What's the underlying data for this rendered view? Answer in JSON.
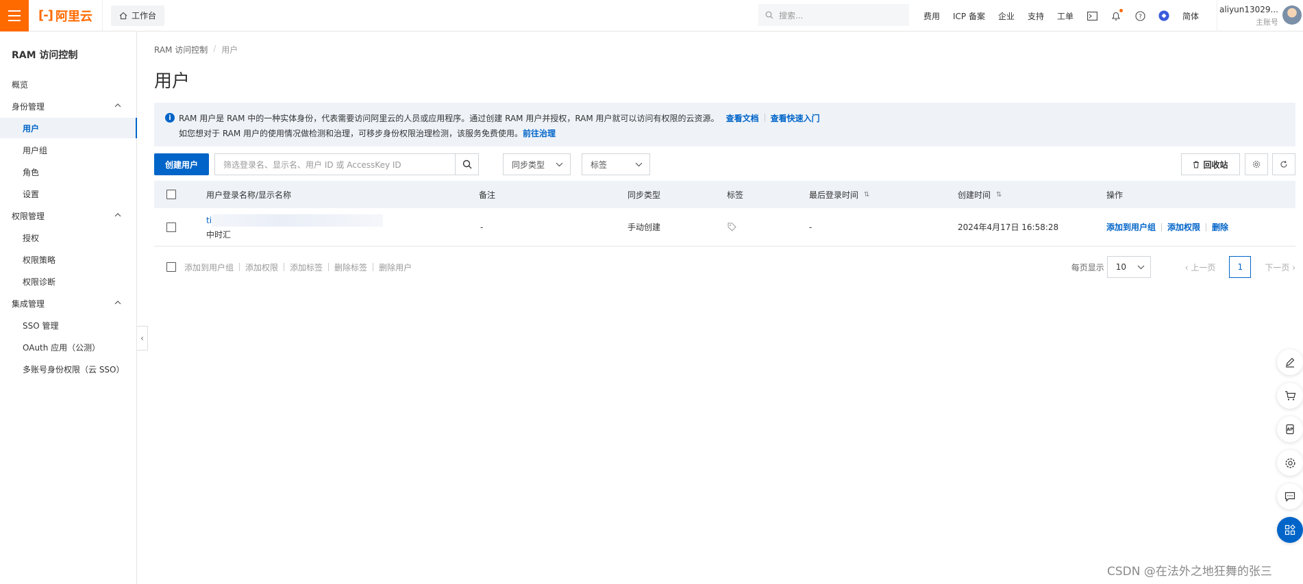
{
  "topbar": {
    "logo_text": "阿里云",
    "workbench_label": "工作台",
    "search_placeholder": "搜索...",
    "nav": [
      "费用",
      "ICP 备案",
      "企业",
      "支持",
      "工单"
    ],
    "lang": "简体",
    "account_name": "aliyun13029...",
    "account_role": "主账号"
  },
  "sidebar": {
    "title": "RAM 访问控制",
    "items": [
      {
        "label": "概览"
      },
      {
        "label": "身份管理"
      },
      {
        "label": "用户"
      },
      {
        "label": "用户组"
      },
      {
        "label": "角色"
      },
      {
        "label": "设置"
      },
      {
        "label": "权限管理"
      },
      {
        "label": "授权"
      },
      {
        "label": "权限策略"
      },
      {
        "label": "权限诊断"
      },
      {
        "label": "集成管理"
      },
      {
        "label": "SSO 管理"
      },
      {
        "label": "OAuth 应用（公测）"
      },
      {
        "label": "多账号身份权限（云 SSO）"
      }
    ]
  },
  "breadcrumb": {
    "root": "RAM 访问控制",
    "current": "用户"
  },
  "page_title": "用户",
  "notice": {
    "line1": "RAM 用户是 RAM 中的一种实体身份，代表需要访问阿里云的人员或应用程序。通过创建 RAM 用户并授权，RAM 用户就可以访问有权限的云资源。",
    "link1": "查看文档",
    "link2": "查看快速入门",
    "line2": "如您想对于 RAM 用户的使用情况做检测和治理，可移步身份权限治理检测，该服务免费使用。",
    "link3": "前往治理"
  },
  "toolbar": {
    "create_label": "创建用户",
    "filter_placeholder": "筛选登录名、显示名、用户 ID 或 AccessKey ID",
    "sync_select": "同步类型",
    "tag_select": "标签",
    "recycle_label": "回收站"
  },
  "table": {
    "headers": [
      "用户登录名称/显示名称",
      "备注",
      "同步类型",
      "标签",
      "最后登录时间",
      "创建时间",
      "操作"
    ],
    "rows": [
      {
        "login_name": "ti",
        "display_name": "中时汇",
        "remark": "-",
        "sync_type": "手动创建",
        "last_login": "-",
        "created": "2024年4月17日 16:58:28",
        "actions": [
          "添加到用户组",
          "添加权限",
          "删除"
        ]
      }
    ]
  },
  "bulk_actions": [
    "添加到用户组",
    "添加权限",
    "添加标签",
    "删除标签",
    "删除用户"
  ],
  "pager": {
    "size_label": "每页显示",
    "size_value": "10",
    "prev": "上一页",
    "page": "1",
    "next": "下一页"
  },
  "watermark": "CSDN @在法外之地狂舞的张三",
  "colors": {
    "brand": "#ff6a00",
    "primary": "#0064c8"
  }
}
